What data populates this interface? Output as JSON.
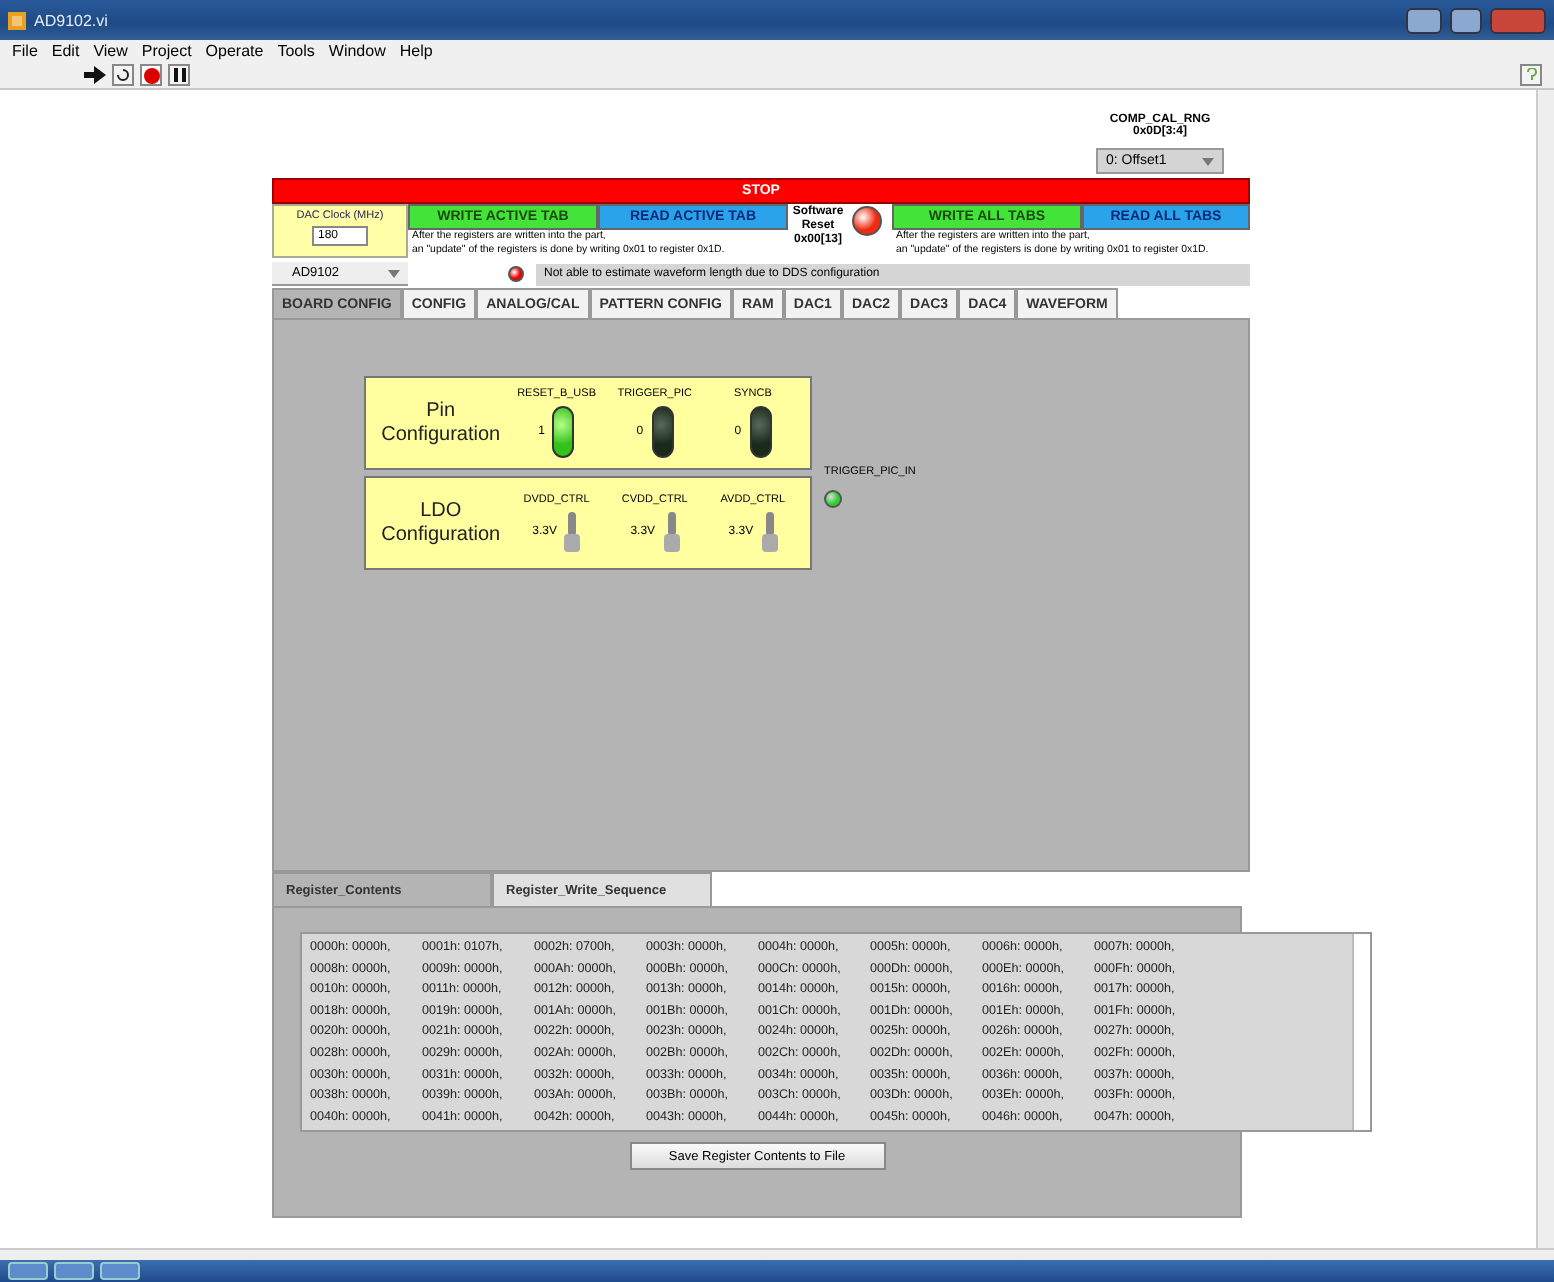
{
  "window": {
    "title": "AD9102.vi"
  },
  "menu": [
    "File",
    "Edit",
    "View",
    "Project",
    "Operate",
    "Tools",
    "Window",
    "Help"
  ],
  "comp_cal_rng": {
    "label": "COMP_CAL_RNG",
    "sublabel": "0x0D[3:4]",
    "value": "0: Offset1"
  },
  "stop_button": "STOP",
  "dac_clock": {
    "label": "DAC Clock (MHz)",
    "value": "180"
  },
  "device_select": "AD9102",
  "write_active": "WRITE ACTIVE TAB",
  "read_active": "READ ACTIVE TAB",
  "software_reset": {
    "label": "Software Reset",
    "sublabel": "0x00[13]",
    "on": true
  },
  "write_all": "WRITE ALL TABS",
  "read_all": "READ ALL TABS",
  "notes": [
    [
      "After the registers are written into the part,",
      "an \"update\" of the registers is done by writing 0x01 to register 0x1D."
    ],
    [
      "After the registers are written into the part,",
      "an \"update\" of the registers is done by writing 0x01 to register 0x1D."
    ]
  ],
  "warning": {
    "text": "Not able to estimate waveform length due to DDS configuration",
    "on": true
  },
  "tabs": [
    {
      "label": "BOARD CONFIG",
      "selected": true
    },
    {
      "label": "CONFIG",
      "selected": false
    },
    {
      "label": "ANALOG/CAL",
      "selected": false
    },
    {
      "label": "PATTERN CONFIG",
      "selected": false
    },
    {
      "label": "RAM",
      "selected": false
    },
    {
      "label": "DAC1",
      "selected": false
    },
    {
      "label": "DAC2",
      "selected": false
    },
    {
      "label": "DAC3",
      "selected": false
    },
    {
      "label": "DAC4",
      "selected": false
    },
    {
      "label": "WAVEFORM",
      "selected": false
    }
  ],
  "pin_config": {
    "title": "Pin Configuration",
    "pins": [
      {
        "name": "RESET_B_USB",
        "value": "1",
        "on": true
      },
      {
        "name": "TRIGGER_PIC",
        "value": "0",
        "on": false
      },
      {
        "name": "SYNCB",
        "value": "0",
        "on": false
      }
    ]
  },
  "ldo_config": {
    "title": "LDO Configuration",
    "controls": [
      {
        "name": "DVDD_CTRL",
        "value": "3.3V",
        "on": false
      },
      {
        "name": "CVDD_CTRL",
        "value": "3.3V",
        "on": false
      },
      {
        "name": "AVDD_CTRL",
        "value": "3.3V",
        "on": false
      }
    ]
  },
  "trigger_pic_in": {
    "label": "TRIGGER_PIC_IN",
    "on": true
  },
  "bottom_tabs": [
    {
      "label": "Register_Contents",
      "selected": true
    },
    {
      "label": "Register_Write_Sequence",
      "selected": false
    }
  ],
  "register_rows": [
    [
      "0000h: 0000h,",
      "0001h: 0107h,",
      "0002h: 0700h,",
      "0003h: 0000h,",
      "0004h: 0000h,",
      "0005h: 0000h,",
      "0006h: 0000h,",
      "0007h: 0000h,"
    ],
    [
      "0008h: 0000h,",
      "0009h: 0000h,",
      "000Ah: 0000h,",
      "000Bh: 0000h,",
      "000Ch: 0000h,",
      "000Dh: 0000h,",
      "000Eh: 0000h,",
      "000Fh: 0000h,"
    ],
    [
      "0010h: 0000h,",
      "0011h: 0000h,",
      "0012h: 0000h,",
      "0013h: 0000h,",
      "0014h: 0000h,",
      "0015h: 0000h,",
      "0016h: 0000h,",
      "0017h: 0000h,"
    ],
    [
      "0018h: 0000h,",
      "0019h: 0000h,",
      "001Ah: 0000h,",
      "001Bh: 0000h,",
      "001Ch: 0000h,",
      "001Dh: 0000h,",
      "001Eh: 0000h,",
      "001Fh: 0000h,"
    ],
    [
      "0020h: 0000h,",
      "0021h: 0000h,",
      "0022h: 0000h,",
      "0023h: 0000h,",
      "0024h: 0000h,",
      "0025h: 0000h,",
      "0026h: 0000h,",
      "0027h: 0000h,"
    ],
    [
      "0028h: 0000h,",
      "0029h: 0000h,",
      "002Ah: 0000h,",
      "002Bh: 0000h,",
      "002Ch: 0000h,",
      "002Dh: 0000h,",
      "002Eh: 0000h,",
      "002Fh: 0000h,"
    ],
    [
      "0030h: 0000h,",
      "0031h: 0000h,",
      "0032h: 0000h,",
      "0033h: 0000h,",
      "0034h: 0000h,",
      "0035h: 0000h,",
      "0036h: 0000h,",
      "0037h: 0000h,"
    ],
    [
      "0038h: 0000h,",
      "0039h: 0000h,",
      "003Ah: 0000h,",
      "003Bh: 0000h,",
      "003Ch: 0000h,",
      "003Dh: 0000h,",
      "003Eh: 0000h,",
      "003Fh: 0000h,"
    ],
    [
      "0040h: 0000h,",
      "0041h: 0000h,",
      "0042h: 0000h,",
      "0043h: 0000h,",
      "0044h: 0000h,",
      "0045h: 0000h,",
      "0046h: 0000h,",
      "0047h: 0000h,"
    ]
  ],
  "save_button": "Save Register Contents to File"
}
